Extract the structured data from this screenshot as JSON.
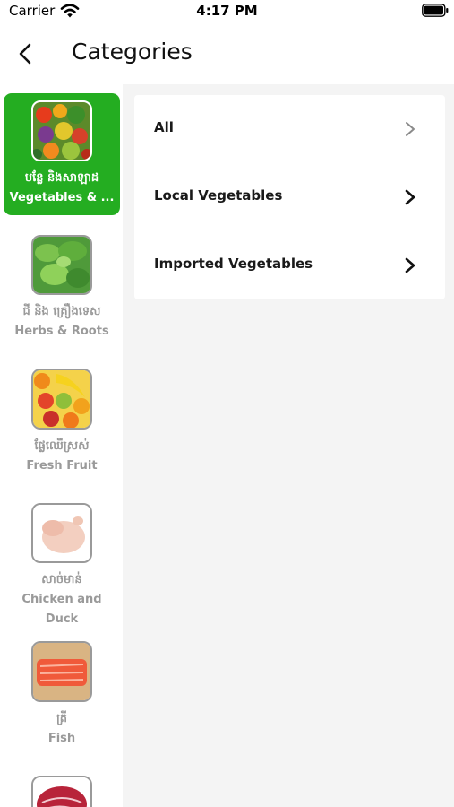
{
  "status_bar": {
    "carrier": "Carrier",
    "time": "4:17 PM"
  },
  "nav": {
    "title": "Categories",
    "back_icon": "chevron-left-icon"
  },
  "sidebar": {
    "items": [
      {
        "km": "បន្លែ និងសាឡាដ",
        "en": "Vegetables & ...",
        "active": true,
        "thumb": "vegetables"
      },
      {
        "km": "ជី និង គ្រឿងទេស",
        "en": "Herbs & Roots",
        "active": false,
        "thumb": "herbs"
      },
      {
        "km": "ផ្លែឈើស្រស់",
        "en": "Fresh Fruit",
        "active": false,
        "thumb": "fruit"
      },
      {
        "km": "សាច់មាន់",
        "en": "Chicken and Duck",
        "active": false,
        "thumb": "chicken"
      },
      {
        "km": "ត្រី",
        "en": "Fish",
        "active": false,
        "thumb": "fish"
      },
      {
        "km": "",
        "en": "",
        "active": false,
        "thumb": "meat"
      }
    ]
  },
  "subcategories": [
    {
      "label": "All",
      "chevron": "light"
    },
    {
      "label": "Local Vegetables",
      "chevron": "dark"
    },
    {
      "label": "Imported Vegetables",
      "chevron": "dark"
    }
  ],
  "colors": {
    "accent": "#24ad21",
    "inactive_text": "#9a9a9a",
    "panel_bg": "#f4f4f4"
  }
}
